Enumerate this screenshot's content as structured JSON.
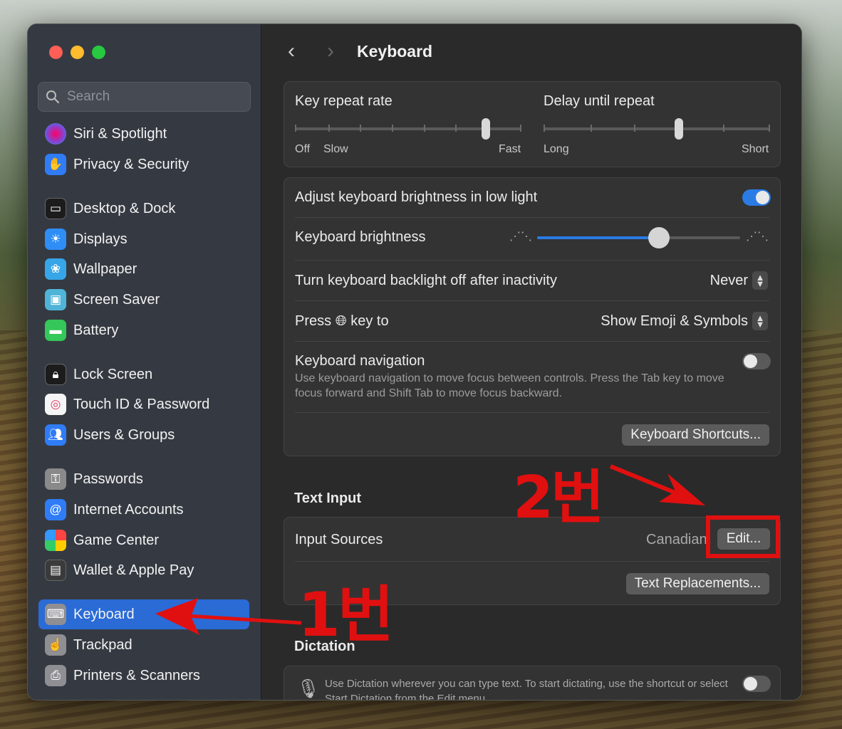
{
  "window": {
    "title": "Keyboard"
  },
  "search": {
    "placeholder": "Search"
  },
  "sidebar": {
    "items": [
      {
        "label": "Siri & Spotlight",
        "icon": "siri-icon",
        "color": "#7a4ad9"
      },
      {
        "label": "Privacy & Security",
        "icon": "hand-icon",
        "color": "#2f7cf6"
      },
      {
        "label": "Desktop & Dock",
        "icon": "dock-icon",
        "color": "#1c1c1c"
      },
      {
        "label": "Displays",
        "icon": "sun-icon",
        "color": "#2f8df6"
      },
      {
        "label": "Wallpaper",
        "icon": "flower-icon",
        "color": "#37a6e8"
      },
      {
        "label": "Screen Saver",
        "icon": "screensaver-icon",
        "color": "#4fb4d8"
      },
      {
        "label": "Battery",
        "icon": "battery-icon",
        "color": "#35c759"
      },
      {
        "label": "Lock Screen",
        "icon": "lock-icon",
        "color": "#1c1c1c"
      },
      {
        "label": "Touch ID & Password",
        "icon": "fingerprint-icon",
        "color": "#f5f5f5"
      },
      {
        "label": "Users & Groups",
        "icon": "users-icon",
        "color": "#2f7cf6"
      },
      {
        "label": "Passwords",
        "icon": "key-icon",
        "color": "#8a8a8a"
      },
      {
        "label": "Internet Accounts",
        "icon": "at-icon",
        "color": "#2f7cf6"
      },
      {
        "label": "Game Center",
        "icon": "gamecenter-icon",
        "color": "#f0f0f0"
      },
      {
        "label": "Wallet & Apple Pay",
        "icon": "wallet-icon",
        "color": "#3a3a3a"
      },
      {
        "label": "Keyboard",
        "icon": "keyboard-icon",
        "color": "#8e8e93",
        "selected": true
      },
      {
        "label": "Trackpad",
        "icon": "trackpad-icon",
        "color": "#8e8e93"
      },
      {
        "label": "Printers & Scanners",
        "icon": "printer-icon",
        "color": "#8e8e93"
      }
    ]
  },
  "repeat": {
    "key_repeat_label": "Key repeat rate",
    "key_repeat_off": "Off",
    "key_repeat_slow": "Slow",
    "key_repeat_fast": "Fast",
    "delay_label": "Delay until repeat",
    "delay_long": "Long",
    "delay_short": "Short"
  },
  "settings": {
    "adjust_brightness_label": "Adjust keyboard brightness in low light",
    "adjust_brightness_on": true,
    "brightness_label": "Keyboard brightness",
    "brightness_level": 0.6,
    "backlight_label": "Turn keyboard backlight off after inactivity",
    "backlight_value": "Never",
    "press_label_a": "Press",
    "press_label_b": "key to",
    "press_value": "Show Emoji & Symbols",
    "nav_label": "Keyboard navigation",
    "nav_desc": "Use keyboard navigation to move focus between controls. Press the Tab key to move focus forward and Shift Tab to move focus backward.",
    "nav_on": false,
    "shortcuts_button": "Keyboard Shortcuts..."
  },
  "text_input": {
    "section_title": "Text Input",
    "input_sources_label": "Input Sources",
    "input_sources_value": "Canadian",
    "edit_button": "Edit...",
    "replacements_button": "Text Replacements..."
  },
  "dictation": {
    "section_title": "Dictation",
    "desc": "Use Dictation wherever you can type text. To start dictating, use the shortcut or select Start Dictation from the Edit menu.",
    "on": false
  },
  "annotations": {
    "step1": "1번",
    "step2": "2번",
    "color": "#e01010"
  }
}
